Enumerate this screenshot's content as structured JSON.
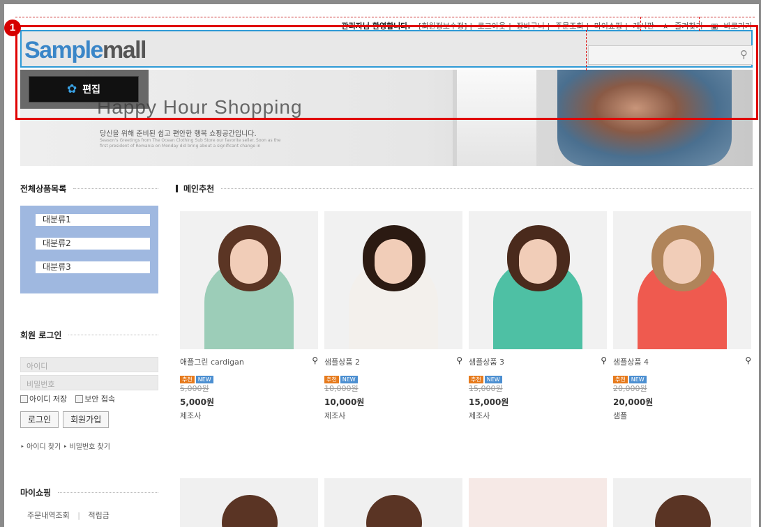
{
  "topbar": {
    "welcome": "관리자님 환영합니다.",
    "links": [
      "[회원정보수정]",
      "로그아웃",
      "장바구니",
      "주문조회",
      "마이쇼핑",
      "게시판"
    ],
    "favorite": "즐겨찾기",
    "shortcut": "바로가기"
  },
  "marker": "1",
  "logo": {
    "part1": "Sample",
    "part2": "mall"
  },
  "search": {
    "placeholder": ""
  },
  "edit": {
    "label": "편집"
  },
  "banner": {
    "title": "Happy Hour Shopping",
    "subtitle": "당신을 위해 준비된 쉽고 편안한 행복 쇼핑공간입니다.",
    "fine": "Season's Greetings from The Ocean Clothing Sub Store our favorite seller. Soon as the first president of Romania on Monday did bring about a significant change in"
  },
  "sidebar": {
    "categories_title": "전체상품목록",
    "categories": [
      "대분류1",
      "대분류2",
      "대분류3"
    ],
    "login_title": "회원 로그인",
    "id_placeholder": "아이디",
    "pw_placeholder": "비밀번호",
    "save_id": "아이디 저장",
    "secure": "보안 접속",
    "login_btn": "로그인",
    "join_btn": "회원가입",
    "find_id": "아이디 찾기",
    "find_pw": "비밀번호 찾기",
    "myshop_title": "마이쇼핑",
    "myshop_links": [
      "주문내역조회",
      "적립금"
    ]
  },
  "main": {
    "title": "메인추천",
    "products": [
      {
        "name": "애플그린 cardigan",
        "badge1": "추천",
        "badge2": "NEW",
        "old_price": "5,000원",
        "price": "5,000원",
        "maker": "제조사",
        "hair": "#5b3524",
        "top": "#9ccdb8"
      },
      {
        "name": "샘플상품 2",
        "badge1": "추천",
        "badge2": "NEW",
        "old_price": "10,000원",
        "price": "10,000원",
        "maker": "제조사",
        "hair": "#2b1a12",
        "top": "#f3f0ec"
      },
      {
        "name": "샘플상품 3",
        "badge1": "추천",
        "badge2": "NEW",
        "old_price": "15,000원",
        "price": "15,000원",
        "maker": "제조사",
        "hair": "#4a2a1c",
        "top": "#4ec0a4"
      },
      {
        "name": "샘플상품 4",
        "badge1": "추천",
        "badge2": "NEW",
        "old_price": "20,000원",
        "price": "20,000원",
        "maker": "샘플",
        "hair": "#b0845a",
        "top": "#ef5a4f"
      }
    ]
  }
}
